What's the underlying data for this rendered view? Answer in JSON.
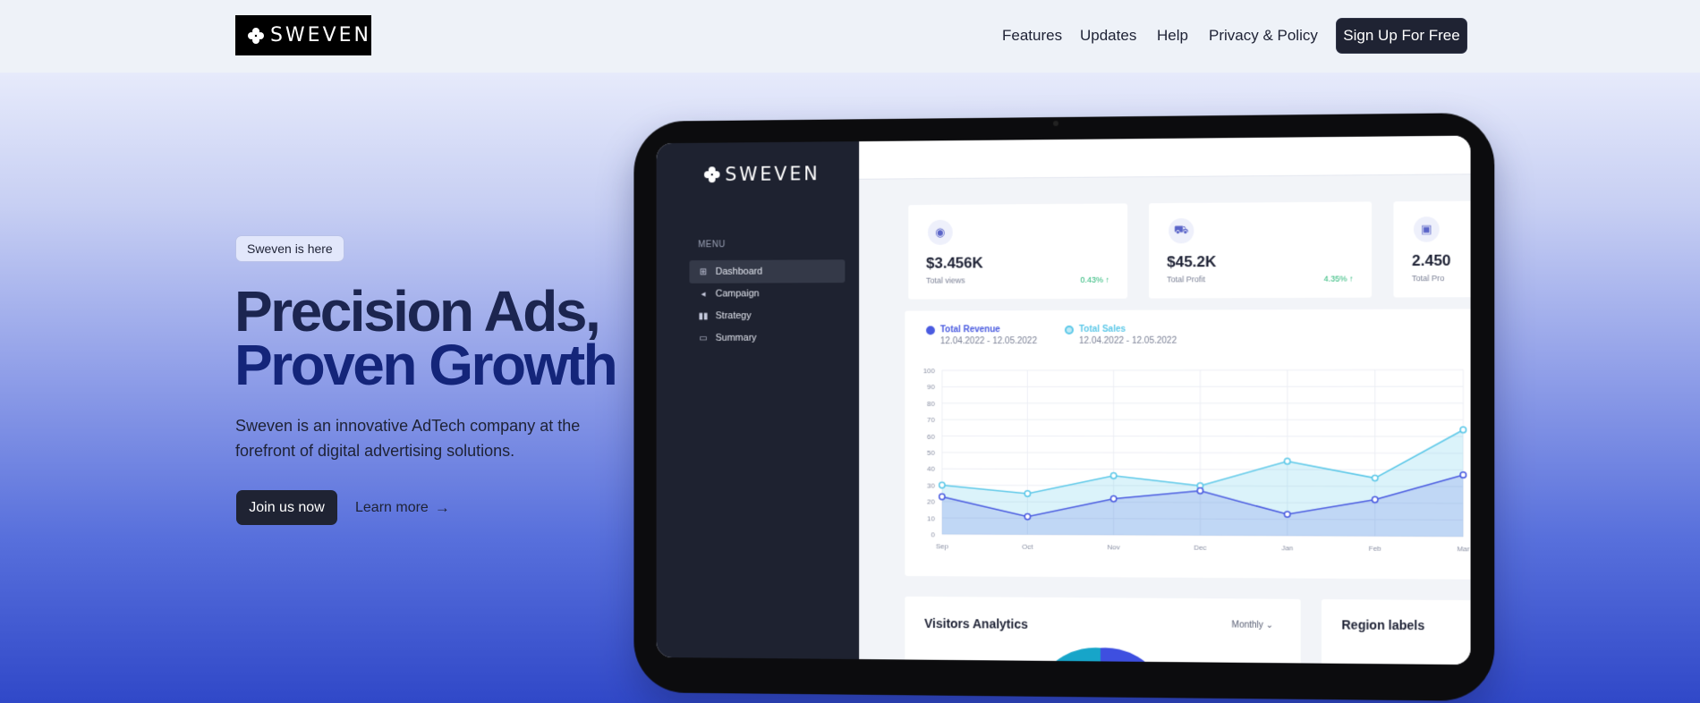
{
  "brand": {
    "name": "SWEVEN"
  },
  "nav": {
    "links": [
      "Features",
      "Updates",
      "Help",
      "Privacy & Policy"
    ],
    "cta": "Sign Up For Free"
  },
  "hero": {
    "badge": "Sweven is here",
    "title_line1": "Precision Ads,",
    "title_line2": "Proven Growth",
    "subtitle": "Sweven is an innovative AdTech company at the forefront of digital advertising solutions.",
    "primary_button": "Join us now",
    "secondary_button": "Learn more"
  },
  "dashboard": {
    "brand": "SWEVEN",
    "menu_label": "MENU",
    "menu": [
      {
        "label": "Dashboard",
        "icon": "grid-icon"
      },
      {
        "label": "Campaign",
        "icon": "megaphone-icon"
      },
      {
        "label": "Strategy",
        "icon": "bars-icon"
      },
      {
        "label": "Summary",
        "icon": "card-icon"
      }
    ],
    "stats": [
      {
        "value": "$3.456K",
        "label": "Total views",
        "change": "0.43% ↑",
        "icon": "eye-icon"
      },
      {
        "value": "$45.2K",
        "label": "Total Profit",
        "change": "4.35% ↑",
        "icon": "cart-icon"
      },
      {
        "value": "2.450",
        "label": "Total Pro",
        "change": "",
        "icon": "bag-icon"
      }
    ],
    "visitors_title": "Visitors Analytics",
    "visitors_period": "Monthly",
    "region_title": "Region labels"
  },
  "chart_data": {
    "type": "area",
    "categories": [
      "Sep",
      "Oct",
      "Nov",
      "Dec",
      "Jan",
      "Feb",
      "Mar"
    ],
    "series": [
      {
        "name": "Total Revenue",
        "range": "12.04.2022 - 12.05.2022",
        "color": "#4a5be0",
        "values": [
          23,
          11,
          22,
          27,
          13,
          22,
          37
        ]
      },
      {
        "name": "Total Sales",
        "range": "12.04.2022 - 12.05.2022",
        "color": "#5cc8e8",
        "values": [
          30,
          25,
          36,
          30,
          45,
          35,
          64
        ]
      }
    ],
    "ylim": [
      0,
      100
    ],
    "yticks": [
      0,
      10,
      20,
      30,
      40,
      50,
      60,
      70,
      80,
      90,
      100
    ],
    "grid": true
  }
}
